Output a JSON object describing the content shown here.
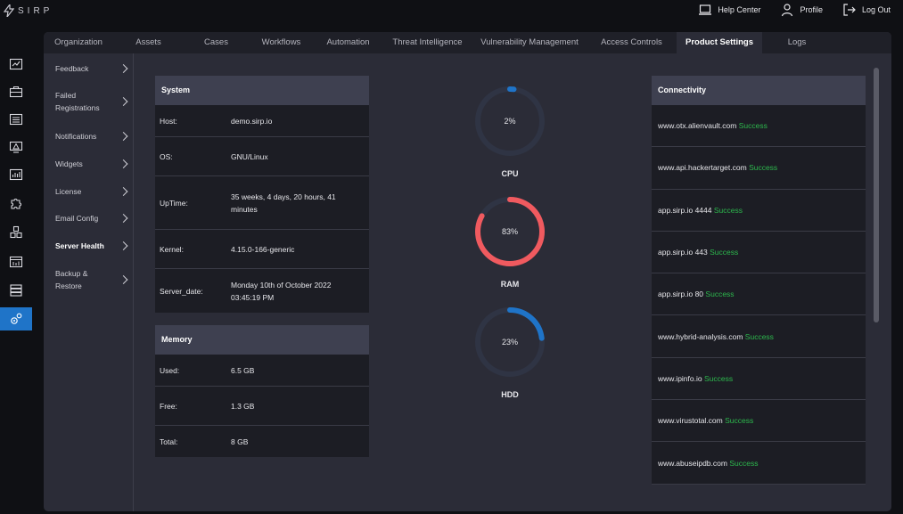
{
  "app": {
    "logo_text": "SIRP"
  },
  "top_actions": [
    {
      "label": "Help Center",
      "icon": "laptop-icon"
    },
    {
      "label": "Profile",
      "icon": "user-icon"
    },
    {
      "label": "Log Out",
      "icon": "logout-icon"
    }
  ],
  "leftnav": [
    {
      "icon": "dashboard-icon"
    },
    {
      "icon": "briefcase-icon"
    },
    {
      "icon": "list-icon"
    },
    {
      "icon": "alert-monitor-icon"
    },
    {
      "icon": "chart-icon"
    },
    {
      "icon": "puzzle-icon"
    },
    {
      "icon": "cubes-icon"
    },
    {
      "icon": "report-icon"
    },
    {
      "icon": "database-icon"
    },
    {
      "icon": "gear-icon",
      "active": true
    }
  ],
  "tabs": [
    {
      "label": "Organization"
    },
    {
      "label": "Assets"
    },
    {
      "label": "Cases"
    },
    {
      "label": "Workflows"
    },
    {
      "label": "Automation"
    },
    {
      "label": "Threat Intelligence"
    },
    {
      "label": "Vulnerability Management"
    },
    {
      "label": "Access Controls"
    },
    {
      "label": "Product Settings",
      "active": true
    },
    {
      "label": "Logs"
    }
  ],
  "subnav": [
    {
      "label": "Feedback"
    },
    {
      "label": "Failed Registrations"
    },
    {
      "label": "Notifications"
    },
    {
      "label": "Widgets"
    },
    {
      "label": "License"
    },
    {
      "label": "Email Config"
    },
    {
      "label": "Server Health",
      "active": true
    },
    {
      "label": "Backup & Restore"
    }
  ],
  "system": {
    "title": "System",
    "rows": [
      {
        "key": "Host:",
        "value": "demo.sirp.io"
      },
      {
        "key": "OS:",
        "value": "GNU/Linux"
      },
      {
        "key": "UpTime:",
        "value": "35 weeks, 4 days, 20 hours, 41 minutes"
      },
      {
        "key": "Kernel:",
        "value": "4.15.0-166-generic"
      },
      {
        "key": "Server_date:",
        "value": "Monday 10th of October 2022 03:45:19 PM"
      }
    ]
  },
  "memory": {
    "title": "Memory",
    "rows": [
      {
        "key": "Used:",
        "value": "6.5 GB"
      },
      {
        "key": "Free:",
        "value": "1.3 GB"
      },
      {
        "key": "Total:",
        "value": "8 GB"
      }
    ]
  },
  "gauges": [
    {
      "name": "CPU",
      "percent": 2,
      "percent_label": "2%",
      "color": "#1f74c8"
    },
    {
      "name": "RAM",
      "percent": 83,
      "percent_label": "83%",
      "color": "#f05a5f"
    },
    {
      "name": "HDD",
      "percent": 23,
      "percent_label": "23%",
      "color": "#1f74c8"
    }
  ],
  "connectivity": {
    "title": "Connectivity",
    "status_color": "#2db84d",
    "rows": [
      {
        "host": "www.otx.alienvault.com",
        "status": "Success"
      },
      {
        "host": "www.api.hackertarget.com",
        "status": "Success"
      },
      {
        "host": "app.sirp.io 4444",
        "status": "Success"
      },
      {
        "host": "app.sirp.io 443",
        "status": "Success"
      },
      {
        "host": "app.sirp.io 80",
        "status": "Success"
      },
      {
        "host": "www.hybrid-analysis.com",
        "status": "Success"
      },
      {
        "host": "www.ipinfo.io",
        "status": "Success"
      },
      {
        "host": "www.virustotal.com",
        "status": "Success"
      },
      {
        "host": "www.abuseipdb.com",
        "status": "Success"
      }
    ]
  }
}
